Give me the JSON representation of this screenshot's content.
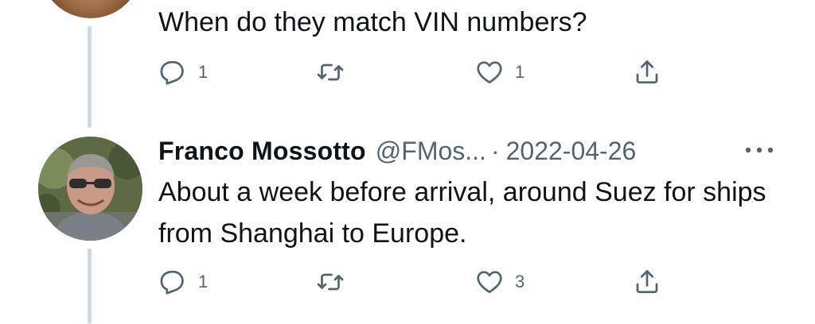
{
  "previous_tweet": {
    "text": "When do they match VIN numbers?",
    "reply_count": "1",
    "retweet_count": "",
    "like_count": "1"
  },
  "reply_tweet": {
    "display_name": "Franco Mossotto",
    "handle": "@FMos...",
    "separator": "·",
    "date": "2022-04-26",
    "text": "About a week before arrival, around Suez for ships from Shanghai to Europe.",
    "reply_count": "1",
    "retweet_count": "",
    "like_count": "3"
  },
  "icons": {
    "reply": "speech-bubble-icon",
    "retweet": "retweet-arrows-icon",
    "like": "heart-icon",
    "share": "share-upload-icon",
    "more": "more-horizontal-icon"
  },
  "colors": {
    "text_primary": "#0f1419",
    "text_secondary": "#536471",
    "thread_line": "#cfd9de",
    "background": "#ffffff"
  }
}
